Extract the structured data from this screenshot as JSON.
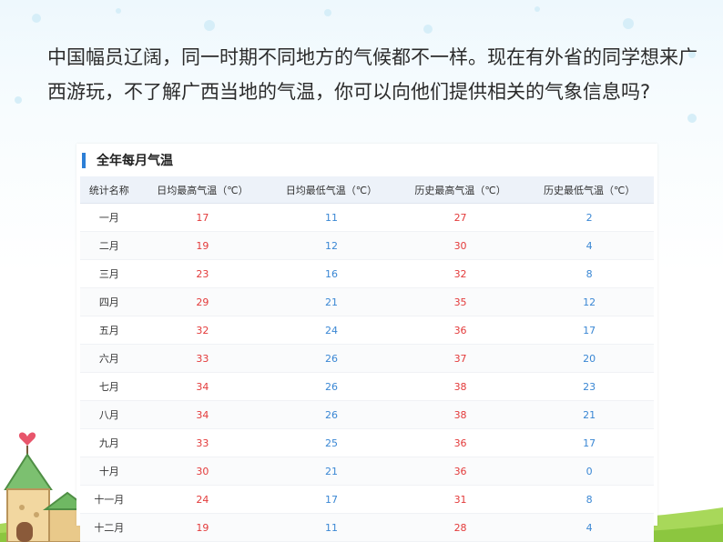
{
  "intro_text": "中国幅员辽阔，同一时期不同地方的气候都不一样。现在有外省的同学想来广西游玩，不了解广西当地的气温，你可以向他们提供相关的气象信息吗?",
  "panel": {
    "title": "全年每月气温",
    "columns": [
      "统计名称",
      "日均最高气温（℃）",
      "日均最低气温（℃）",
      "历史最高气温（℃）",
      "历史最低气温（℃）"
    ],
    "rows": [
      {
        "month": "一月",
        "avg_high": "17",
        "avg_low": "11",
        "rec_high": "27",
        "rec_low": "2"
      },
      {
        "month": "二月",
        "avg_high": "19",
        "avg_low": "12",
        "rec_high": "30",
        "rec_low": "4"
      },
      {
        "month": "三月",
        "avg_high": "23",
        "avg_low": "16",
        "rec_high": "32",
        "rec_low": "8"
      },
      {
        "month": "四月",
        "avg_high": "29",
        "avg_low": "21",
        "rec_high": "35",
        "rec_low": "12"
      },
      {
        "month": "五月",
        "avg_high": "32",
        "avg_low": "24",
        "rec_high": "36",
        "rec_low": "17"
      },
      {
        "month": "六月",
        "avg_high": "33",
        "avg_low": "26",
        "rec_high": "37",
        "rec_low": "20"
      },
      {
        "month": "七月",
        "avg_high": "34",
        "avg_low": "26",
        "rec_high": "38",
        "rec_low": "23"
      },
      {
        "month": "八月",
        "avg_high": "34",
        "avg_low": "26",
        "rec_high": "38",
        "rec_low": "21"
      },
      {
        "month": "九月",
        "avg_high": "33",
        "avg_low": "25",
        "rec_high": "36",
        "rec_low": "17"
      },
      {
        "month": "十月",
        "avg_high": "30",
        "avg_low": "21",
        "rec_high": "36",
        "rec_low": "0"
      },
      {
        "month": "十一月",
        "avg_high": "24",
        "avg_low": "17",
        "rec_high": "31",
        "rec_low": "8"
      },
      {
        "month": "十二月",
        "avg_high": "19",
        "avg_low": "11",
        "rec_high": "28",
        "rec_low": "4"
      }
    ]
  },
  "colors": {
    "accent": "#2d7fd6",
    "high_value": "#e33a3a",
    "low_value": "#3a87d4",
    "header_bg": "#edf2f9"
  },
  "decorations": {
    "house_icon": "cartoon-house-icon",
    "heart_icon": "heart-icon"
  }
}
